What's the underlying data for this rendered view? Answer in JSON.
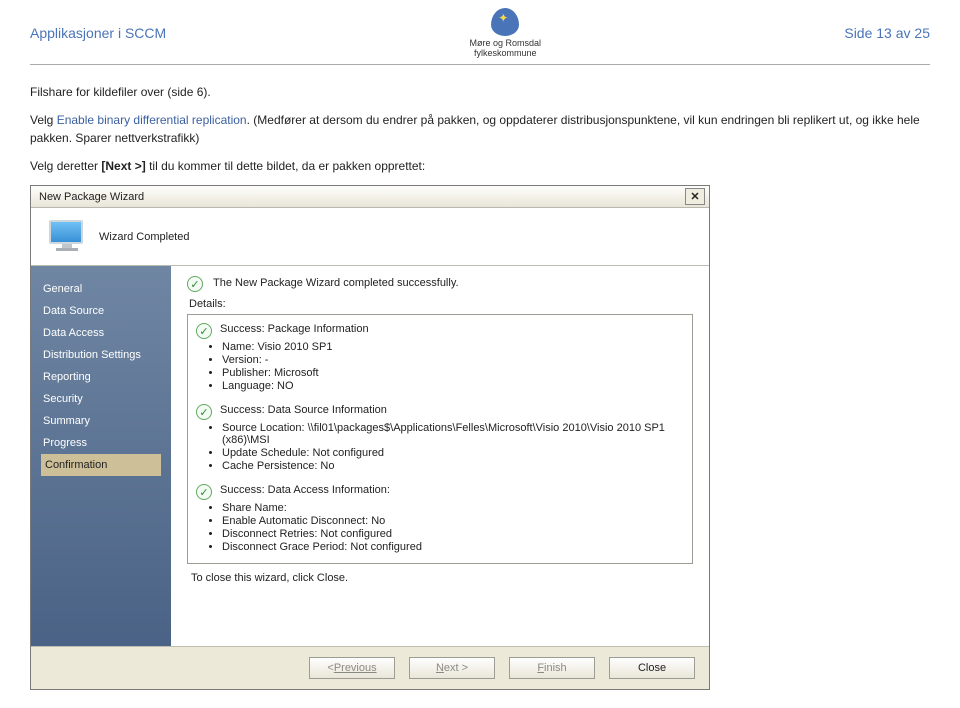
{
  "page": {
    "left_title": "Applikasjoner i SCCM",
    "right_title": "Side 13 av 25",
    "logo_caption": "Møre og Romsdal\nfylkeskommune"
  },
  "intro": {
    "line1_a": "Filshare for kildefiler over (side 6).",
    "line2_prefix": "Velg ",
    "line2_emph": "Enable binary differential replication",
    "line2_rest": ". (Medfører at dersom du endrer på pakken, og oppdaterer distribusjonspunktene, vil kun endringen bli replikert ut, og ikke hele pakken. Sparer nettverkstrafikk)",
    "line3_prefix": "Velg deretter ",
    "line3_bracket": "[Next >]",
    "line3_rest": " til du kommer til dette bildet, da er pakken opprettet:"
  },
  "wizard": {
    "title": "New Package Wizard",
    "header": "Wizard Completed",
    "sidebar": [
      "General",
      "Data Source",
      "Data Access",
      "Distribution Settings",
      "Reporting",
      "Security",
      "Summary",
      "Progress",
      "Confirmation"
    ],
    "selected_index": 8,
    "success_msg": "The New Package Wizard completed successfully.",
    "details_label": "Details:",
    "sections": [
      {
        "title": "Success: Package Information",
        "items": [
          "Name: Visio 2010 SP1",
          "Version: -",
          "Publisher: Microsoft",
          "Language: NO"
        ]
      },
      {
        "title": "Success: Data Source Information",
        "items": [
          "Source Location: \\\\fil01\\packages$\\Applications\\Felles\\Microsoft\\Visio 2010\\Visio 2010 SP1 (x86)\\MSI",
          "Update Schedule: Not configured",
          "Cache Persistence: No"
        ]
      },
      {
        "title": "Success: Data Access Information:",
        "items": [
          "Share Name:",
          "Enable Automatic Disconnect: No",
          "Disconnect Retries: Not configured",
          "Disconnect Grace Period: Not configured"
        ]
      }
    ],
    "hint": "To close this wizard, click Close.",
    "buttons": {
      "previous": "Previous",
      "next": "Next >",
      "finish": "Finish",
      "close": "Close"
    }
  }
}
